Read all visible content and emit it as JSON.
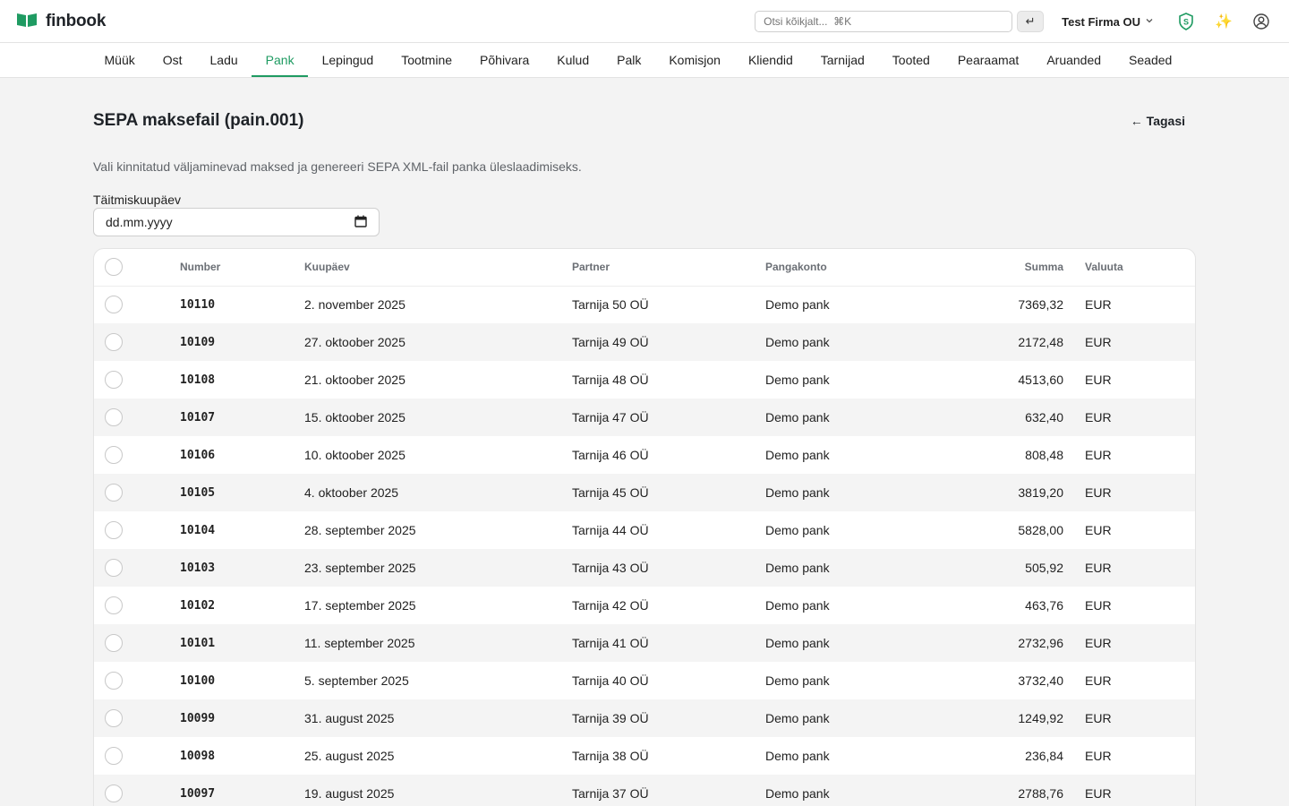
{
  "app": {
    "name": "finbook"
  },
  "topbar": {
    "search_placeholder": "Otsi kõikjalt...  ⌘K",
    "enter_glyph": "↵",
    "company": "Test Firma OU",
    "shield_letter": "S",
    "sparkle_glyph": "✨"
  },
  "nav": {
    "items": [
      "Müük",
      "Ost",
      "Ladu",
      "Pank",
      "Lepingud",
      "Tootmine",
      "Põhivara",
      "Kulud",
      "Palk",
      "Komisjon",
      "Kliendid",
      "Tarnijad",
      "Tooted",
      "Pearaamat",
      "Aruanded",
      "Seaded"
    ],
    "active": "Pank"
  },
  "page": {
    "title": "SEPA maksefail (pain.001)",
    "back": "← Tagasi",
    "description": "Vali kinnitatud väljaminevad maksed ja genereeri SEPA XML-fail panka üleslaadimiseks.",
    "date_label": "Täitmiskuupäev",
    "date_placeholder": "dd.mm.yyyy"
  },
  "table": {
    "headers": {
      "number": "Number",
      "date": "Kuupäev",
      "partner": "Partner",
      "bank": "Pangakonto",
      "sum": "Summa",
      "currency": "Valuuta"
    },
    "rows": [
      {
        "number": "10110",
        "date": "2. november 2025",
        "partner": "Tarnija 50 OÜ",
        "bank": "Demo pank",
        "sum": "7369,32",
        "currency": "EUR"
      },
      {
        "number": "10109",
        "date": "27. oktoober 2025",
        "partner": "Tarnija 49 OÜ",
        "bank": "Demo pank",
        "sum": "2172,48",
        "currency": "EUR"
      },
      {
        "number": "10108",
        "date": "21. oktoober 2025",
        "partner": "Tarnija 48 OÜ",
        "bank": "Demo pank",
        "sum": "4513,60",
        "currency": "EUR"
      },
      {
        "number": "10107",
        "date": "15. oktoober 2025",
        "partner": "Tarnija 47 OÜ",
        "bank": "Demo pank",
        "sum": "632,40",
        "currency": "EUR"
      },
      {
        "number": "10106",
        "date": "10. oktoober 2025",
        "partner": "Tarnija 46 OÜ",
        "bank": "Demo pank",
        "sum": "808,48",
        "currency": "EUR"
      },
      {
        "number": "10105",
        "date": "4. oktoober 2025",
        "partner": "Tarnija 45 OÜ",
        "bank": "Demo pank",
        "sum": "3819,20",
        "currency": "EUR"
      },
      {
        "number": "10104",
        "date": "28. september 2025",
        "partner": "Tarnija 44 OÜ",
        "bank": "Demo pank",
        "sum": "5828,00",
        "currency": "EUR"
      },
      {
        "number": "10103",
        "date": "23. september 2025",
        "partner": "Tarnija 43 OÜ",
        "bank": "Demo pank",
        "sum": "505,92",
        "currency": "EUR"
      },
      {
        "number": "10102",
        "date": "17. september 2025",
        "partner": "Tarnija 42 OÜ",
        "bank": "Demo pank",
        "sum": "463,76",
        "currency": "EUR"
      },
      {
        "number": "10101",
        "date": "11. september 2025",
        "partner": "Tarnija 41 OÜ",
        "bank": "Demo pank",
        "sum": "2732,96",
        "currency": "EUR"
      },
      {
        "number": "10100",
        "date": "5. september 2025",
        "partner": "Tarnija 40 OÜ",
        "bank": "Demo pank",
        "sum": "3732,40",
        "currency": "EUR"
      },
      {
        "number": "10099",
        "date": "31. august 2025",
        "partner": "Tarnija 39 OÜ",
        "bank": "Demo pank",
        "sum": "1249,92",
        "currency": "EUR"
      },
      {
        "number": "10098",
        "date": "25. august 2025",
        "partner": "Tarnija 38 OÜ",
        "bank": "Demo pank",
        "sum": "236,84",
        "currency": "EUR"
      },
      {
        "number": "10097",
        "date": "19. august 2025",
        "partner": "Tarnija 37 OÜ",
        "bank": "Demo pank",
        "sum": "2788,76",
        "currency": "EUR"
      }
    ]
  },
  "colors": {
    "brand_green": "#1f9b62",
    "accent_yellow": "#f2b705"
  }
}
